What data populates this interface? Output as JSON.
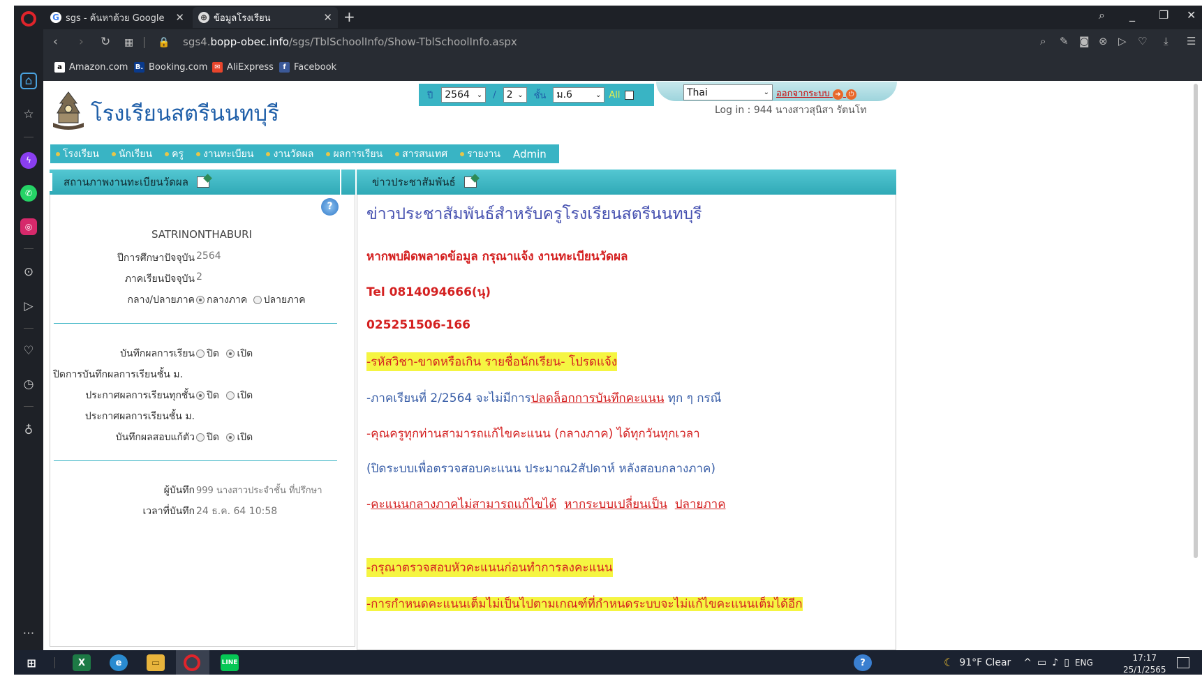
{
  "browser": {
    "tabs": [
      {
        "title": "sgs - ค้นหาด้วย Google"
      },
      {
        "title": "ข้อมูลโรงเรียน"
      }
    ],
    "url_domain": "sgs4.",
    "url_host": "bopp-obec.info",
    "url_path": "/sgs/TblSchoolInfo/Show-TblSchoolInfo.aspx",
    "bookmarks": [
      {
        "label": "Amazon.com",
        "icon": "amazon-icon",
        "icon_text": "a",
        "color": "#ffffff"
      },
      {
        "label": "Booking.com",
        "icon": "booking-icon",
        "icon_text": "B.",
        "color": "#0a3a8c"
      },
      {
        "label": "AliExpress",
        "icon": "aliexpress-icon",
        "icon_text": "✉",
        "color": "#e8452c"
      },
      {
        "label": "Facebook",
        "icon": "facebook-icon",
        "icon_text": "f",
        "color": "#3b5998"
      }
    ]
  },
  "header": {
    "school_name": "โรงเรียนสตรีนนทบุรี",
    "year_label": "ปี",
    "year_value": "2564",
    "sep": "/",
    "term_value": "2",
    "class_label": "ชั้น",
    "class_value": "ม.6",
    "all_label": "All",
    "language": "Thai",
    "logout": "ออกจากระบบ",
    "login_info": "Log in : 944 นางสาวสุนิสา  รัตนโท"
  },
  "menu": [
    "โรงเรียน",
    "นักเรียน",
    "ครู",
    "งานทะเบียน",
    "งานวัดผล",
    "ผลการเรียน",
    "สารสนเทศ",
    "รายงาน",
    "Admin"
  ],
  "left_panel": {
    "title": "สถานภาพงานทะเบียนวัดผล",
    "school_code": "SATRINONTHABURI",
    "academic_year_label": "ปีการศึกษาปัจจุบัน",
    "academic_year_value": "2564",
    "semester_label": "ภาคเรียนปัจจุบัน",
    "semester_value": "2",
    "mid_final_label": "กลาง/ปลายภาค",
    "mid_option": "กลางภาค",
    "final_option": "ปลายภาค",
    "record_grades_label": "บันทึกผลการเรียน",
    "close_record_label": "ปิดการบันทึกผลการเรียนชั้น ม.",
    "announce_all_label": "ประกาศผลการเรียนทุกชั้น",
    "announce_class_label": "ประกาศผลการเรียนชั้น ม.",
    "record_retest_label": "บันทึกผลสอบแก้ตัว",
    "off": "ปิด",
    "on": "เปิด",
    "recorder_label": "ผู้บันทึก",
    "recorder_value": "999  นางสาวประจำชั้น  ที่ปรึกษา",
    "record_time_label": "เวลาที่บันทึก",
    "record_time_value": "24  ธ.ค.  64  10:58"
  },
  "right_panel": {
    "title": "ข่าวประชาสัมพันธ์",
    "headline": "ข่าวประชาสัมพันธ์สำหรับครูโรงเรียนสตรีนนทบุรี",
    "line1": "หากพบผิดพลาดข้อมูล กรุณาแจ้ง งานทะเบียนวัดผล",
    "line2": "Tel  0814094666(นุ)",
    "line3": "025251506-166",
    "line4": "-รหัสวิชา-ขาดหรือเกิน รายชื่อนักเรียน-  โปรดแจ้ง",
    "line5a": "-ภาคเรียนที่ 2/2564 จะไม่มีการ",
    "line5b": "ปลดล็อกการบันทึกคะแนน",
    "line5c": " ทุก ๆ กรณี",
    "line6": "-คุณครูทุกท่านสามารถแก้ไขคะแนน (กลางภาค) ได้ทุกวันทุกเวลา",
    "line7": "(ปิดระบบเพื่อตรวจสอบคะแนน  ประมาณ2สัปดาห์  หลังสอบกลางภาค)",
    "line8a": "คะแนนกลางภาคไม่สามารถแก้ไขได้",
    "line8b": "หากระบบเปลี่ยนเป็น",
    "line8c": "ปลายภาค",
    "line9": "-กรุณาตรวจสอบหัวคะแนนก่อนทำการลงคะแนน",
    "line10a": "-การกำหนดคะแนนเต็มไม่เป็นไปตามเกณฑ์ที่กำหนด",
    "line10b": "ระบบจะไม่แก้ไขคะแนนเต็มได้อีก"
  },
  "taskbar": {
    "weather": "91°F  Clear",
    "lang": "ENG",
    "time": "17:17",
    "date": "25/1/2565"
  }
}
